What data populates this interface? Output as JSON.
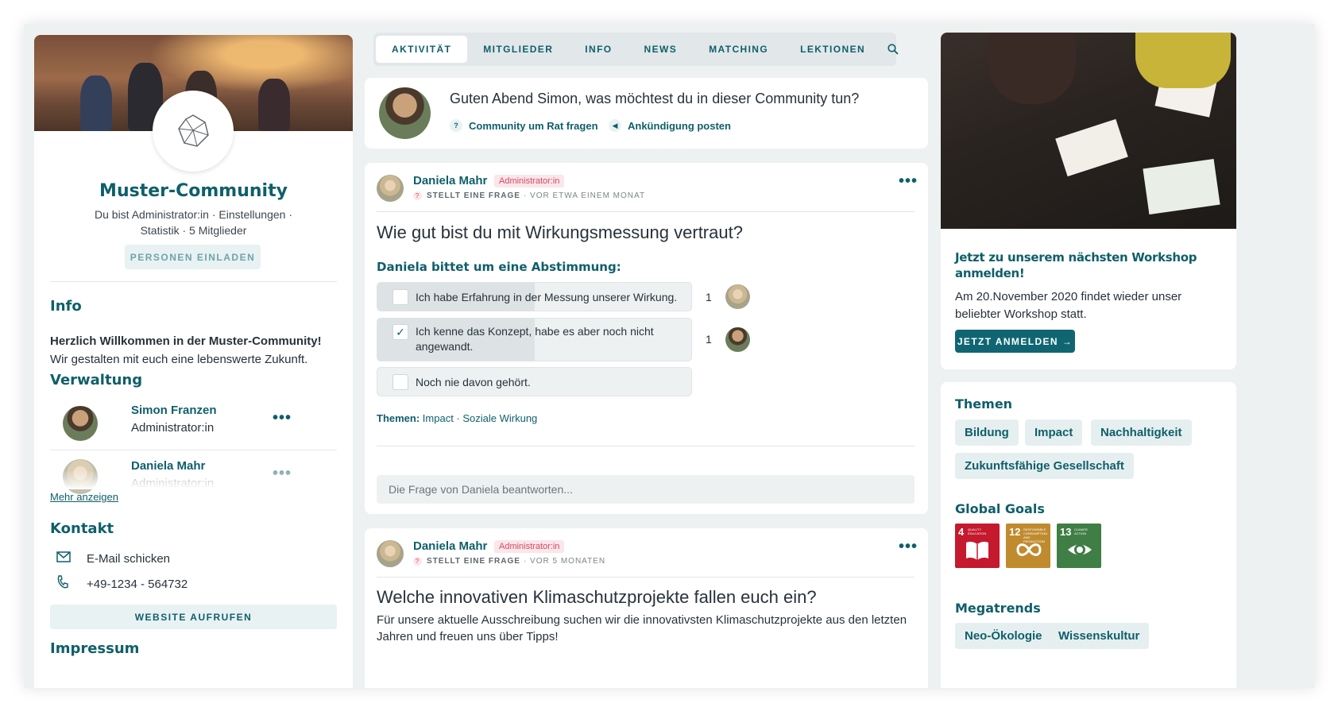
{
  "tabs": [
    "AKTIVITÄT",
    "MITGLIEDER",
    "INFO",
    "NEWS",
    "MATCHING",
    "LEKTIONEN"
  ],
  "community": {
    "name": "Muster-Community",
    "meta_line1": "Du bist Administrator:in · Einstellungen ·",
    "meta_line2": "Statistik · 5 Mitglieder",
    "invite_label": "PERSONEN EINLADEN"
  },
  "info": {
    "title": "Info",
    "bold": "Herzlich Willkommen in der Muster-Community!",
    "text": "Wir gestalten mit euch eine lebenswerte Zukunft."
  },
  "admin": {
    "title": "Verwaltung",
    "members": [
      {
        "name": "Simon Franzen",
        "role": "Administrator:in"
      },
      {
        "name": "Daniela Mahr",
        "role": "Administrator:in"
      }
    ],
    "more_label": "Mehr anzeigen"
  },
  "contact": {
    "title": "Kontakt",
    "email_label": "E-Mail schicken",
    "phone": "+49-1234 - 564732",
    "website_label": "WEBSITE AUFRUFEN"
  },
  "impressum_title": "Impressum",
  "composer": {
    "question": "Guten Abend Simon, was möchtest du in dieser Community tun?",
    "action1": "Community um Rat fragen",
    "action2": "Ankündigung posten"
  },
  "posts": [
    {
      "author": "Daniela Mahr",
      "badge": "Administrator:in",
      "type": "STELLT EINE FRAGE",
      "time": "· VOR ETWA EINEM MONAT",
      "title": "Wie gut bist du mit Wirkungsmessung vertraut?",
      "poll_heading": "Daniela bittet um eine Abstimmung:",
      "poll": [
        {
          "label": "Ich habe Erfahrung in der Messung unserer Wirkung.",
          "count": "1",
          "checked": false,
          "share": 0.5
        },
        {
          "label": "Ich kenne das Konzept, habe es aber noch nicht angewandt.",
          "count": "1",
          "checked": true,
          "share": 0.5
        },
        {
          "label": "Noch nie davon gehört.",
          "count": "",
          "checked": false,
          "share": 0
        }
      ],
      "themes_label": "Themen:",
      "themes": "Impact · Soziale Wirkung",
      "answer_placeholder": "Die Frage von Daniela beantworten..."
    },
    {
      "author": "Daniela Mahr",
      "badge": "Administrator:in",
      "type": "STELLT EINE FRAGE",
      "time": "· VOR 5 MONATEN",
      "title": "Welche innovativen Klimaschutzprojekte fallen euch ein?",
      "body": "Für unsere aktuelle Ausschreibung suchen wir die innovativsten Klimaschutzprojekte aus den letzten Jahren und freuen uns über Tipps!"
    }
  ],
  "promo": {
    "title": "Jetzt zu unserem nächsten Workshop anmelden!",
    "text": "Am 20.November 2020 findet wieder unser beliebter Workshop statt.",
    "button": "JETZT ANMELDEN →"
  },
  "topics": {
    "title": "Themen",
    "chips": [
      "Bildung",
      "Impact",
      "Nachhaltigkeit",
      "Zukunftsfähige Gesellschaft"
    ]
  },
  "goals": {
    "title": "Global Goals",
    "items": [
      {
        "num": "4",
        "label": "QUALITY EDUCATION",
        "color": "#c5192d"
      },
      {
        "num": "12",
        "label": "RESPONSIBLE CONSUMPTION AND PRODUCTION",
        "color": "#bf8b2e"
      },
      {
        "num": "13",
        "label": "CLIMATE ACTION",
        "color": "#3f7e44"
      }
    ]
  },
  "megatrends": {
    "title": "Megatrends",
    "chips": [
      "Neo-Ökologie",
      "Wissenskultur"
    ]
  },
  "colors": {
    "brand": "#0f5f6a",
    "badge": "#d24a63",
    "background": "#eef1f2"
  }
}
